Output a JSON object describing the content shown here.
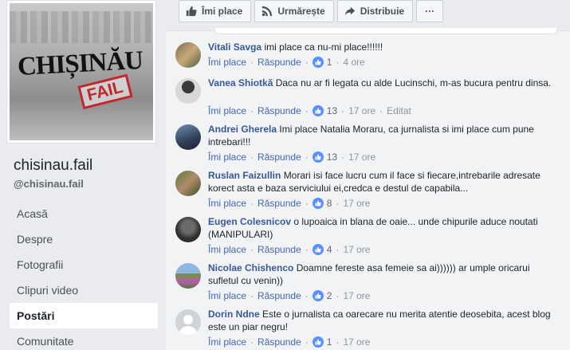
{
  "sidebar": {
    "logo_text": "CHIȘINĂU",
    "logo_stamp": "FAIL",
    "page_name": "chisinau.fail",
    "page_handle": "@chisinau.fail",
    "nav": [
      "Acasă",
      "Despre",
      "Fotografii",
      "Clipuri video",
      "Postări",
      "Comunitate"
    ],
    "active_index": 4
  },
  "actions": {
    "like": "Îmi place",
    "follow": "Urmărește",
    "share": "Distribuie",
    "more": "···"
  },
  "labels": {
    "like": "Îmi place",
    "reply": "Răspunde"
  },
  "comments": [
    {
      "author": "Vitali Savga",
      "text": "imi place ca nu-mi place!!!!!!",
      "likes": "1",
      "time": "4 ore",
      "edited": ""
    },
    {
      "author": "Vanea Shiotkă",
      "text": "Daca nu ar fi legata cu alde Lucinschi, m-as bucura pentru dinsa.",
      "likes": "13",
      "time": "17 ore",
      "edited": "Editat"
    },
    {
      "author": "Andrei Gherela",
      "text": "Imi place Natalia Moraru, ca jurnalista si imi place cum pune intrebari!!!",
      "likes": "13",
      "time": "17 ore",
      "edited": ""
    },
    {
      "author": "Ruslan Faizullin",
      "text": "Morari isi face lucru cum il face si fiecare,intrebarile adresate korect asta e baza serviciului ei,credca e destul de capabila...",
      "likes": "8",
      "time": "17 ore",
      "edited": ""
    },
    {
      "author": "Eugen Colesnicov",
      "text": "o lupoaica in blana de oaie... unde chipurile aduce noutati (MANIPULARI)",
      "likes": "4",
      "time": "17 ore",
      "edited": ""
    },
    {
      "author": "Nicolae Chishenco",
      "text": "Doamne fereste asa femeie sa ai)))))) ar umple oricarui sufletul cu venin))",
      "likes": "2",
      "time": "17 ore",
      "edited": ""
    },
    {
      "author": "Dorin Ndne",
      "text": "Este o jurnalista ca oarecare nu merita atentie deosebita, acest blog este un piar negru!",
      "likes": "1",
      "time": "17 ore",
      "edited": ""
    }
  ]
}
